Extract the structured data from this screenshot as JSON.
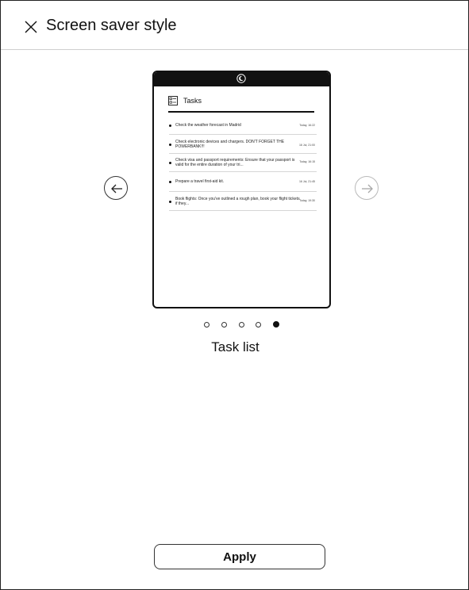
{
  "header": {
    "title": "Screen saver style"
  },
  "preview": {
    "tasks_title": "Tasks",
    "tasks": [
      {
        "text": "Check the weather forecast in Madrid",
        "date": "Today, 16:22"
      },
      {
        "text": "Check electronic devices and chargers. DON'T FORGET THE POWERBANK!!!",
        "date": "16 Jul, 21:00"
      },
      {
        "text": "Check visa and passport requirements: Ensure that your passport is valid for the entire duration of your tri...",
        "date": "Today, 16:15"
      },
      {
        "text": "Prepare a travel first-aid kit.",
        "date": "16 Jul, 21:45"
      },
      {
        "text": "Book flights: Once you've outlined a rough plan, book your flight tickets if they...",
        "date": "Today, 19:30"
      }
    ]
  },
  "pager": {
    "count": 5,
    "active_index": 4
  },
  "style_name": "Task list",
  "apply_label": "Apply",
  "colors": {
    "ink": "#111111",
    "divider": "#cfcfcf",
    "disabled": "#b9b9b9"
  }
}
